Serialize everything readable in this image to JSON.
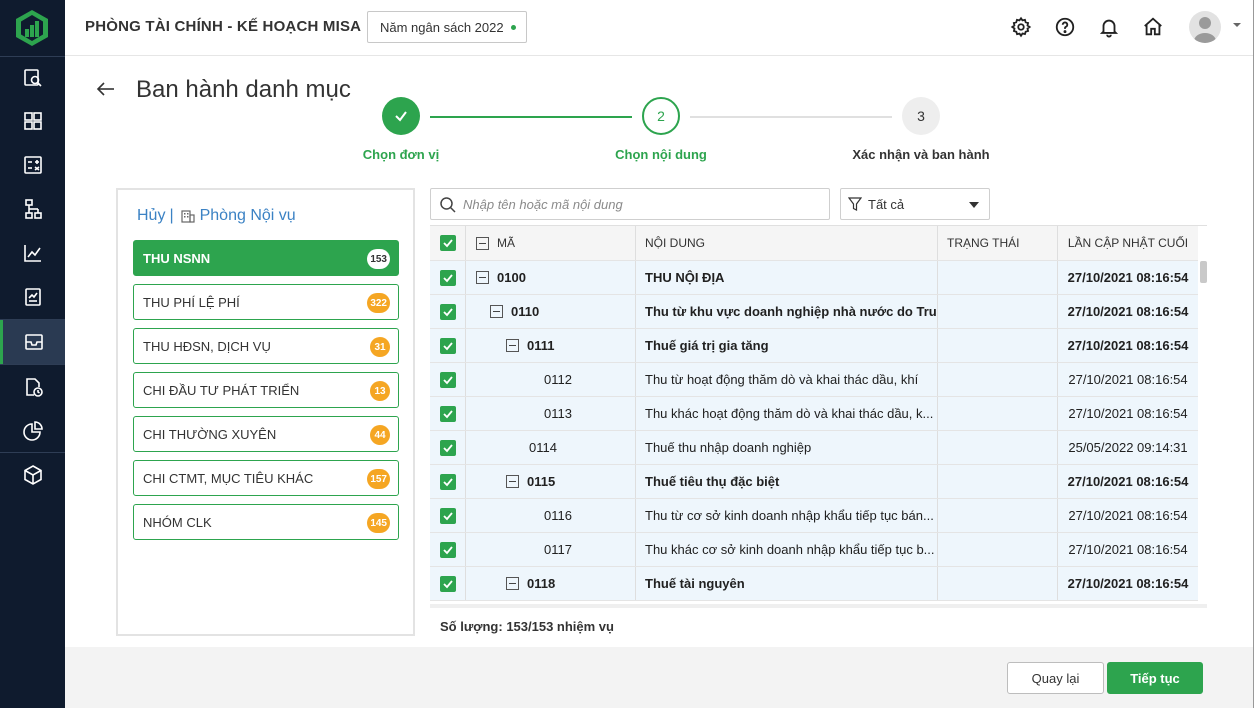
{
  "header": {
    "org_title": "PHÒNG TÀI CHÍNH - KẾ HOẠCH MISA",
    "budget_year": "Năm ngân sách 2022"
  },
  "page": {
    "title": "Ban hành danh mục"
  },
  "stepper": {
    "steps": [
      {
        "number": "",
        "label": "Chọn đơn vị",
        "state": "done"
      },
      {
        "number": "2",
        "label": "Chọn nội dung",
        "state": "current"
      },
      {
        "number": "3",
        "label": "Xác nhận và ban hành",
        "state": "pending"
      }
    ]
  },
  "left_panel": {
    "cancel_label": "Hủy",
    "separator": "|",
    "unit_label": "Phòng Nội vụ",
    "categories": [
      {
        "label": "THU NSNN",
        "count": "153"
      },
      {
        "label": "THU PHÍ LỆ PHÍ",
        "count": "322"
      },
      {
        "label": "THU HĐSN, DỊCH VỤ",
        "count": "31"
      },
      {
        "label": "CHI ĐẦU TƯ PHÁT TRIỂN",
        "count": "13"
      },
      {
        "label": "CHI THƯỜNG XUYÊN",
        "count": "44"
      },
      {
        "label": "CHI CTMT, MỤC TIÊU KHÁC",
        "count": "157"
      },
      {
        "label": "NHÓM CLK",
        "count": "145"
      }
    ]
  },
  "search": {
    "placeholder": "Nhập tên hoặc mã nội dung",
    "value": ""
  },
  "filter": {
    "selected": "Tất cả"
  },
  "table": {
    "columns": [
      "MÃ",
      "NỘI DUNG",
      "TRẠNG THÁI",
      "LẦN CẬP NHẬT CUỐI"
    ],
    "rows": [
      {
        "code": "0100",
        "name": "THU NỘI ĐỊA",
        "status": "",
        "updated": "27/10/2021 08:16:54"
      },
      {
        "code": "0110",
        "name": "Thu từ khu vực doanh nghiệp nhà nước do Trun...",
        "status": "",
        "updated": "27/10/2021 08:16:54"
      },
      {
        "code": "0111",
        "name": "Thuế giá trị gia tăng",
        "status": "",
        "updated": "27/10/2021 08:16:54"
      },
      {
        "code": "0112",
        "name": "Thu từ hoạt động thăm dò và khai thác dầu, khí",
        "status": "",
        "updated": "27/10/2021 08:16:54"
      },
      {
        "code": "0113",
        "name": "Thu khác hoạt động thăm dò và khai thác dầu, k...",
        "status": "",
        "updated": "27/10/2021 08:16:54"
      },
      {
        "code": "0114",
        "name": "Thuế thu nhập doanh nghiệp",
        "status": "",
        "updated": "25/05/2022 09:14:31"
      },
      {
        "code": "0115",
        "name": "Thuế tiêu thụ đặc biệt",
        "status": "",
        "updated": "27/10/2021 08:16:54"
      },
      {
        "code": "0116",
        "name": "Thu từ cơ sở kinh doanh nhập khẩu tiếp tục bán...",
        "status": "",
        "updated": "27/10/2021 08:16:54"
      },
      {
        "code": "0117",
        "name": "Thu khác cơ sở kinh doanh nhập khẩu tiếp tục b...",
        "status": "",
        "updated": "27/10/2021 08:16:54"
      },
      {
        "code": "0118",
        "name": "Thuế tài nguyên",
        "status": "",
        "updated": "27/10/2021 08:16:54"
      }
    ]
  },
  "summary": {
    "count_text": "Số lượng: 153/153 nhiệm vụ"
  },
  "footer": {
    "back_label": "Quay lại",
    "next_label": "Tiếp tục"
  },
  "colors": {
    "accent": "#2da44e",
    "rail_bg": "#0f1b2e",
    "badge": "#f5a623",
    "link": "#3b82c4",
    "row_bg": "#eef6fc"
  }
}
